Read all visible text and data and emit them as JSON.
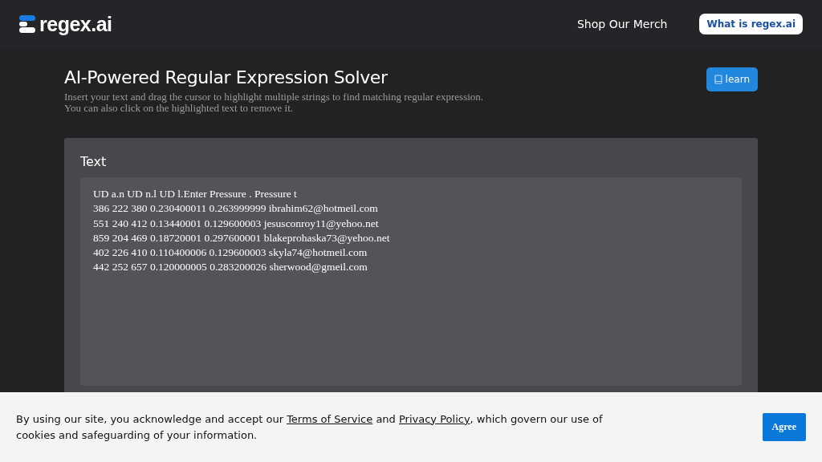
{
  "header": {
    "logo": "regex.ai",
    "nav_link": "Shop Our Merch",
    "about_button": "What is regex.ai"
  },
  "intro": {
    "title": "AI-Powered Regular Expression Solver",
    "description_lines": [
      "Insert your text and drag the cursor to highlight multiple strings to find matching regular expression.",
      "You can also click on the highlighted text to remove it."
    ],
    "learn_button": "learn"
  },
  "text_panel": {
    "label": "Text",
    "value": "UD a.n UD n.l UD l.Enter Pressure . Pressure t\n386 222 380 0.230400011 0.263999999 ibrahim62@hotmeil.com\n551 240 412 0.13440001 0.129600003 jesusconroy11@yehoo.net\n859 204 469 0.18720001 0.297600001 blakeprohaska73@yehoo.net\n402 226 410 0.110400006 0.129600003 skyla74@hotmeil.com\n442 252 657 0.120000005 0.283200026 sherwood@gmeil.com"
  },
  "cookie_banner": {
    "text_before": "By using our site, you acknowledge and accept our ",
    "terms_link": "Terms of Service",
    "text_middle": " and ",
    "privacy_link": "Privacy Policy",
    "text_after": ", which govern our use of cookies and safeguarding of your information.",
    "agree_button": "Agree"
  }
}
